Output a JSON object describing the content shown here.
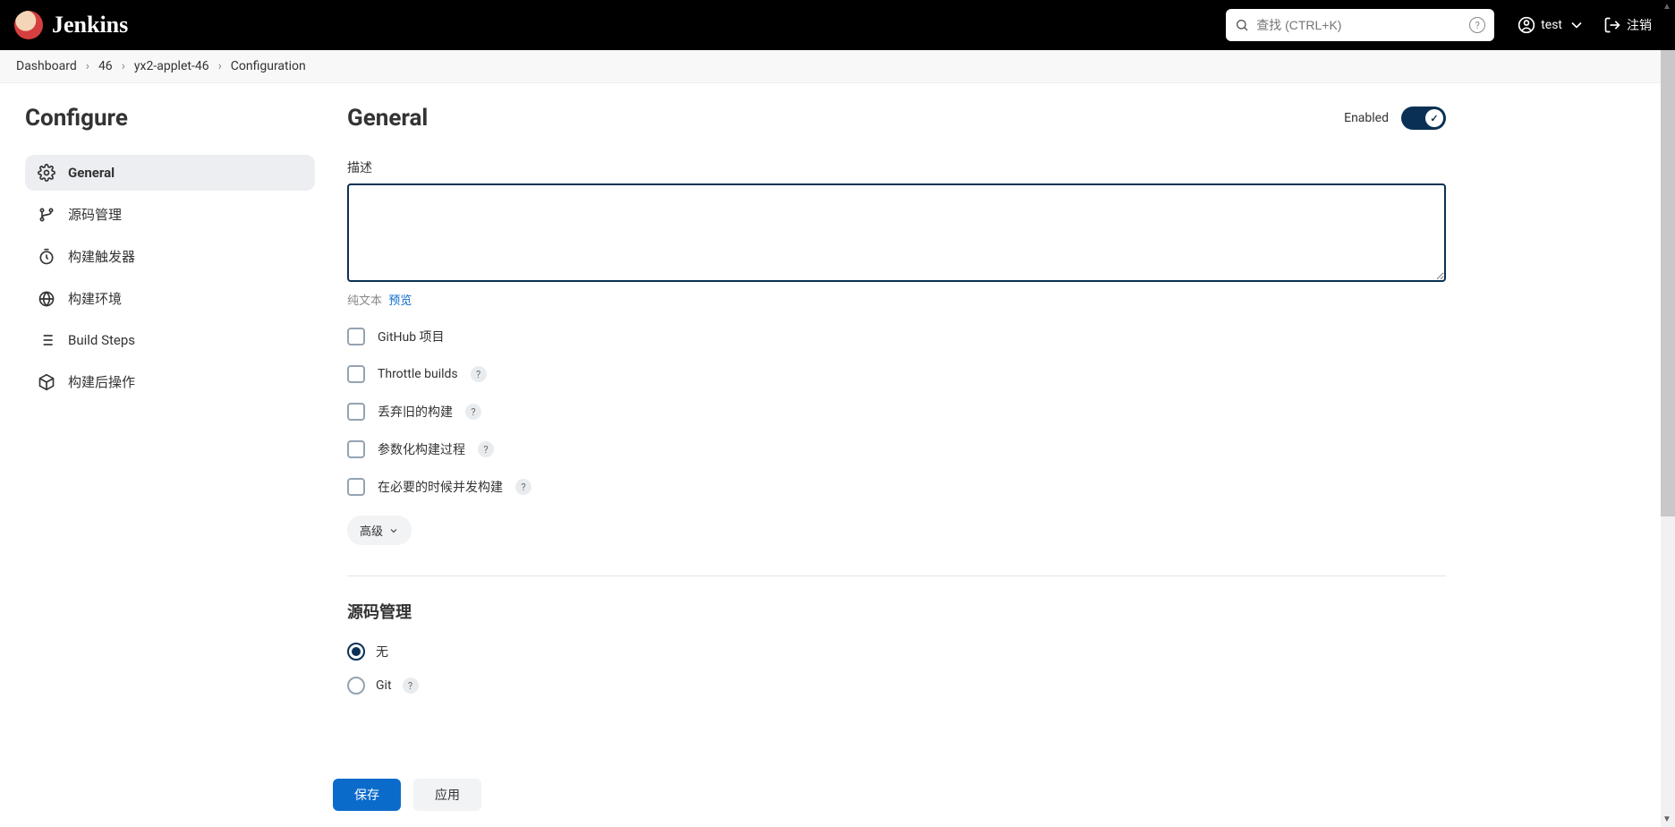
{
  "header": {
    "brand": "Jenkins",
    "search_placeholder": "查找 (CTRL+K)",
    "user": "test",
    "logout": "注销"
  },
  "breadcrumbs": [
    "Dashboard",
    "46",
    "yx2-applet-46",
    "Configuration"
  ],
  "sidebar": {
    "title": "Configure",
    "items": [
      {
        "label": "General"
      },
      {
        "label": "源码管理"
      },
      {
        "label": "构建触发器"
      },
      {
        "label": "构建环境"
      },
      {
        "label": "Build Steps"
      },
      {
        "label": "构建后操作"
      }
    ]
  },
  "general": {
    "heading": "General",
    "enabled_label": "Enabled",
    "desc_label": "描述",
    "desc_value": "",
    "plaintext": "纯文本",
    "preview": "预览",
    "checks": [
      {
        "label": "GitHub 项目",
        "help": false
      },
      {
        "label": "Throttle builds",
        "help": true
      },
      {
        "label": "丢弃旧的构建",
        "help": true
      },
      {
        "label": "参数化构建过程",
        "help": true
      },
      {
        "label": "在必要的时候并发构建",
        "help": true
      }
    ],
    "advanced": "高级"
  },
  "scm": {
    "heading": "源码管理",
    "options": [
      {
        "label": "无",
        "selected": true,
        "help": false
      },
      {
        "label": "Git",
        "selected": false,
        "help": true
      }
    ]
  },
  "buttons": {
    "save": "保存",
    "apply": "应用"
  }
}
